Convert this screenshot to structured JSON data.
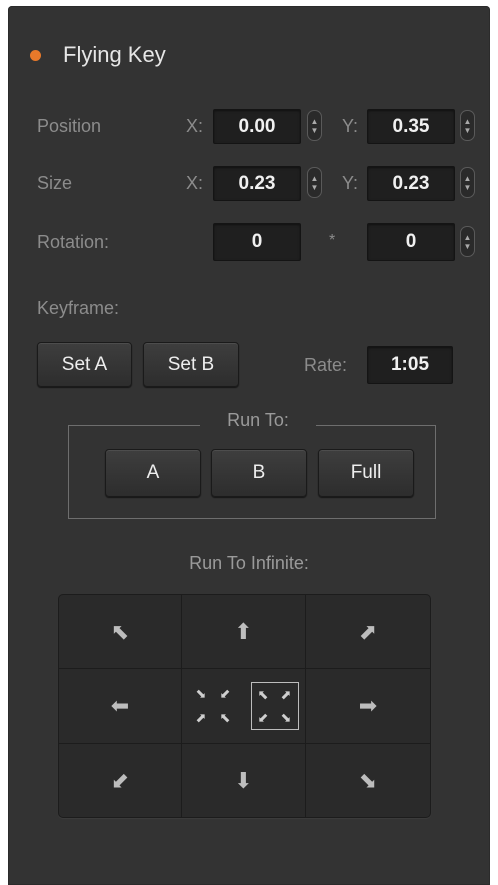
{
  "title": "Flying Key",
  "colors": {
    "accent": "#e8792a",
    "panel": "#333333",
    "field": "#1f1f1f"
  },
  "position": {
    "label": "Position",
    "x_label": "X:",
    "x_value": "0.00",
    "y_label": "Y:",
    "y_value": "0.35"
  },
  "size": {
    "label": "Size",
    "x_label": "X:",
    "x_value": "0.23",
    "y_label": "Y:",
    "y_value": "0.23"
  },
  "rotation": {
    "label": "Rotation:",
    "value1": "0",
    "separator": "*",
    "value2": "0"
  },
  "keyframe": {
    "label": "Keyframe:",
    "set_a": "Set A",
    "set_b": "Set B",
    "rate_label": "Rate:",
    "rate_value": "1:05"
  },
  "run_to": {
    "label": "Run To:",
    "a": "A",
    "b": "B",
    "full": "Full"
  },
  "run_to_infinite": {
    "label": "Run To Infinite:",
    "icons": {
      "up_left": "⬉",
      "up": "⬆",
      "up_right": "⬈",
      "left": "⬅",
      "right": "➡",
      "down_left": "⬋",
      "down": "⬇",
      "down_right": "⬊",
      "zoom_in": [
        "⬊",
        "⬋",
        "⬈",
        "⬉"
      ],
      "zoom_out": [
        "⬉",
        "⬈",
        "⬋",
        "⬊"
      ]
    }
  }
}
